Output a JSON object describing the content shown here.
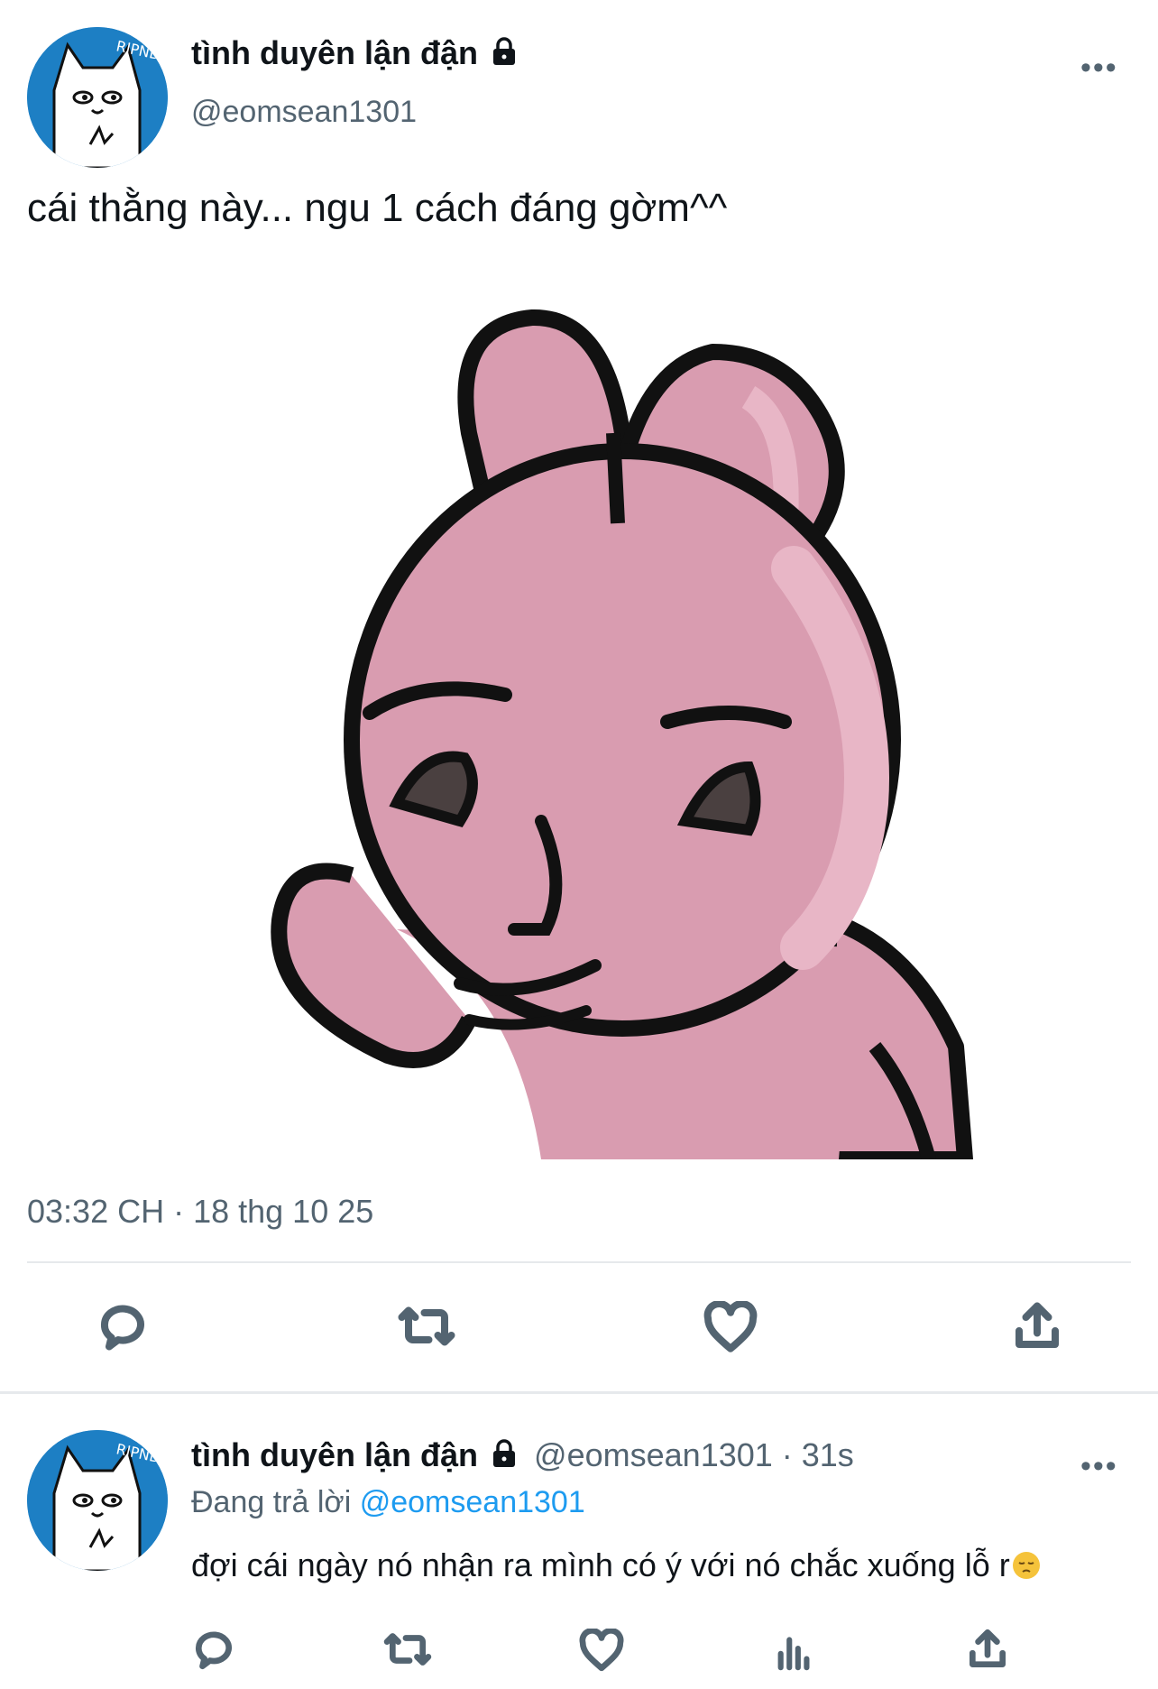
{
  "main_tweet": {
    "display_name": "tình duyên lận đận",
    "handle": "@eomsean1301",
    "text": "cái thằng này... ngu 1 cách đáng gờm^^",
    "timestamp": "03:32 CH · 18 thg 10 25",
    "more_label": "•••",
    "avatar_text": "RIPND",
    "icons": [
      "lock-icon",
      "more-icon",
      "reply-icon",
      "retweet-icon",
      "like-icon",
      "share-icon"
    ]
  },
  "reply": {
    "display_name": "tình duyên lận đận",
    "meta": "@eomsean1301 · 31s",
    "replying_to_label": "Đang trả lời",
    "replying_to_handle": "@eomsean1301",
    "text": "đợi cái ngày nó nhận ra mình có ý với nó chắc xuống lỗ r",
    "more_label": "•••",
    "avatar_text": "RIPND",
    "icons": [
      "reply-icon",
      "retweet-icon",
      "like-icon",
      "views-icon",
      "share-icon"
    ]
  },
  "colors": {
    "accent": "#1d9bf0",
    "secondary_text": "#536471",
    "bunny_pink": "#d99cb0",
    "avatar_blue": "#1d7fc4"
  }
}
